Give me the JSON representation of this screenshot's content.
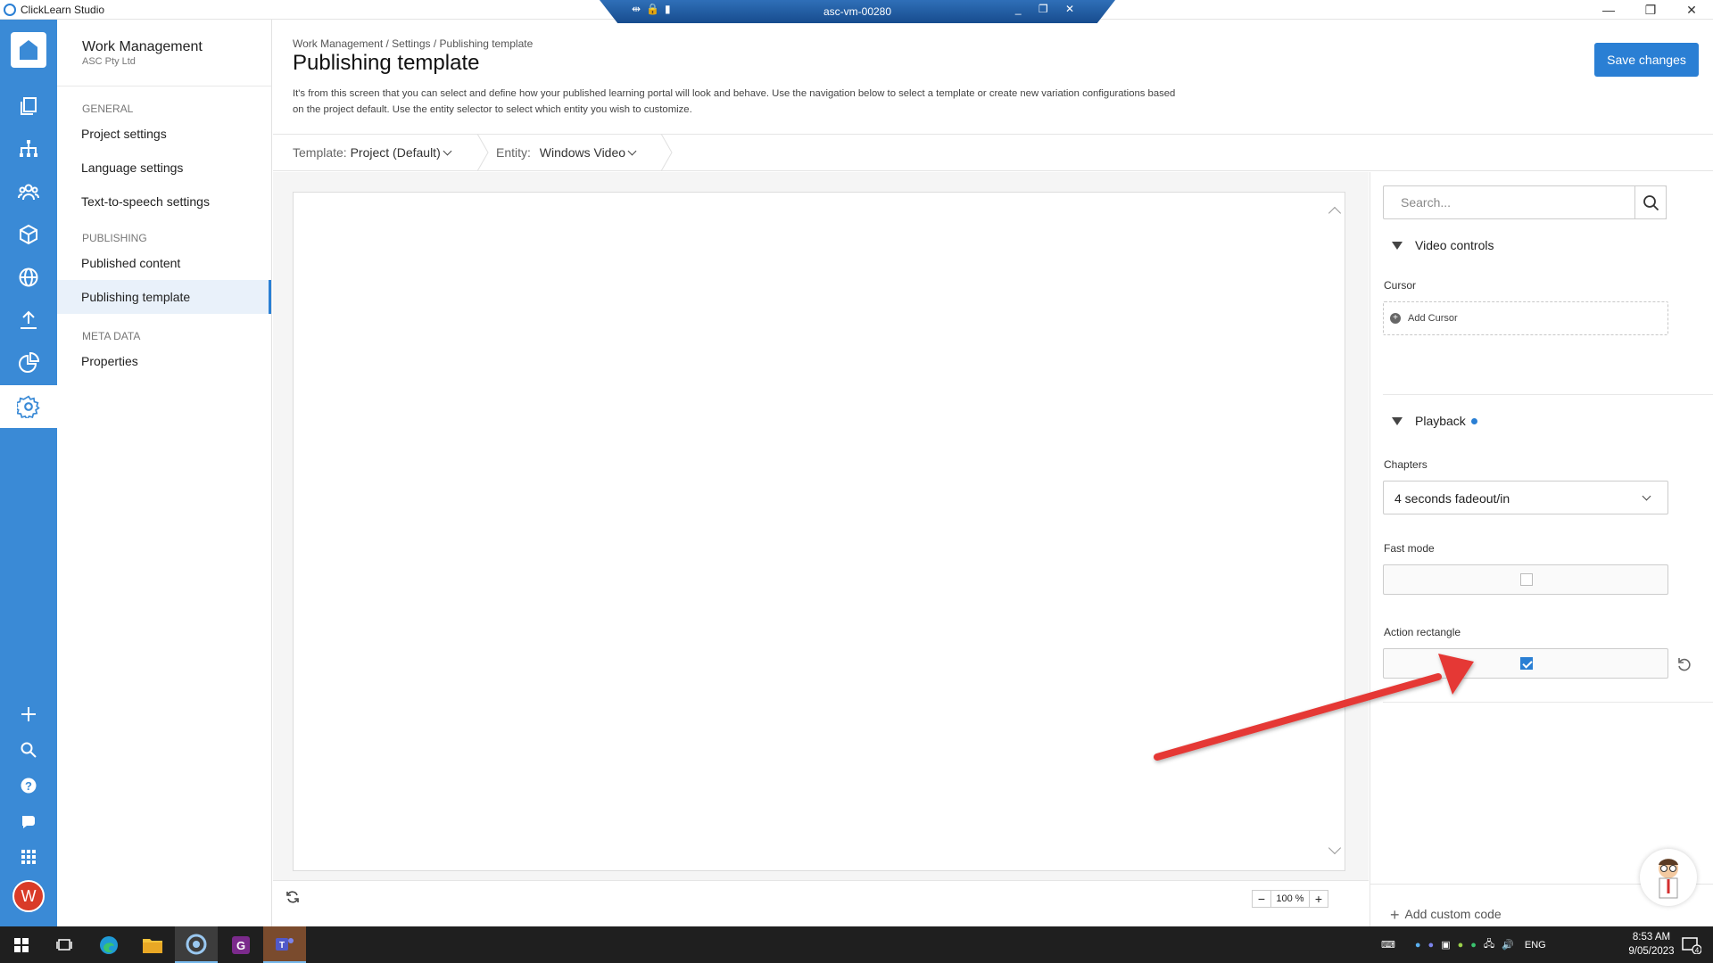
{
  "window": {
    "app_title": "ClickLearn Studio",
    "minimize": "—",
    "restore": "❐",
    "close": "✕"
  },
  "vm_bar": {
    "name": "asc-vm-00280"
  },
  "rail": {
    "avatar_initial": "W"
  },
  "settings_nav": {
    "workspace": "Work Management",
    "org": "ASC Pty Ltd",
    "sections": [
      {
        "title": "GENERAL",
        "items": [
          "Project settings",
          "Language settings",
          "Text-to-speech settings"
        ]
      },
      {
        "title": "PUBLISHING",
        "items": [
          "Published content",
          "Publishing template"
        ]
      },
      {
        "title": "META DATA",
        "items": [
          "Properties"
        ]
      }
    ],
    "active_item": "Publishing template"
  },
  "header": {
    "breadcrumb": "Work Management / Settings / Publishing template",
    "title": "Publishing template",
    "description": "It's from this screen that you can select and define how your published learning portal will look and behave. Use the navigation below to select a template or create new variation configurations based on the project default. Use the entity selector to select which entity you wish to customize.",
    "save_label": "Save changes"
  },
  "selectors": {
    "template_label": "Template:",
    "template_value": "Project (Default)",
    "entity_label": "Entity:",
    "entity_value": "Windows Video"
  },
  "preview": {
    "zoom_minus": "−",
    "zoom_value": "100 %",
    "zoom_plus": "+"
  },
  "panel": {
    "search_placeholder": "Search...",
    "video_controls": {
      "title": "Video controls",
      "cursor_label": "Cursor",
      "add_cursor": "Add Cursor"
    },
    "playback": {
      "title": "Playback",
      "chapters_label": "Chapters",
      "chapters_value": "4 seconds fadeout/in",
      "fast_mode_label": "Fast mode",
      "fast_mode_checked": false,
      "action_rectangle_label": "Action rectangle",
      "action_rectangle_checked": true
    },
    "add_custom_code": "Add custom code"
  },
  "taskbar": {
    "language": "ENG",
    "time": "8:53 AM",
    "date": "9/05/2023",
    "notification_count": "4"
  },
  "colors": {
    "accent": "#2a7fd4",
    "rail": "#3a8ad6",
    "arrow": "#e53935"
  }
}
